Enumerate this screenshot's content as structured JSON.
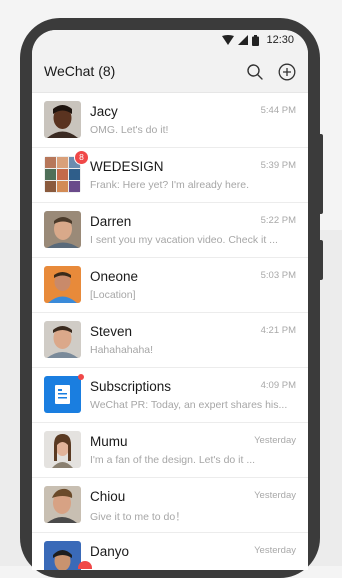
{
  "status": {
    "time": "12:30"
  },
  "header": {
    "title": "WeChat (8)"
  },
  "colors": {
    "badge": "#f04848",
    "subscriptions": "#1a7ee0",
    "phone_frame": "#3b3b3b"
  },
  "chats": [
    {
      "name": "Jacy",
      "time": "5:44 PM",
      "preview": "OMG. Let's do it!",
      "avatar": "person"
    },
    {
      "name": "WEDESIGN",
      "time": "5:39 PM",
      "preview": "Frank: Here yet? I'm already here.",
      "avatar": "group",
      "badge": "8"
    },
    {
      "name": "Darren",
      "time": "5:22 PM",
      "preview": "I sent you my vacation video. Check it ...",
      "avatar": "person"
    },
    {
      "name": "Oneone",
      "time": "5:03 PM",
      "preview": "[Location]",
      "avatar": "person"
    },
    {
      "name": "Steven",
      "time": "4:21 PM",
      "preview": "Hahahahaha!",
      "avatar": "person"
    },
    {
      "name": "Subscriptions",
      "time": "4:09 PM",
      "preview": "WeChat PR: Today, an expert shares his...",
      "avatar": "subscriptions-icon",
      "unread_dot": true
    },
    {
      "name": "Mumu",
      "time": "Yesterday",
      "preview": "I'm a fan of the design. Let's do it ...",
      "avatar": "person"
    },
    {
      "name": "Chiou",
      "time": "Yesterday",
      "preview": "Give it to me to do！",
      "avatar": "person"
    },
    {
      "name": "Danyo",
      "time": "Yesterday",
      "preview": "",
      "avatar": "person"
    }
  ]
}
